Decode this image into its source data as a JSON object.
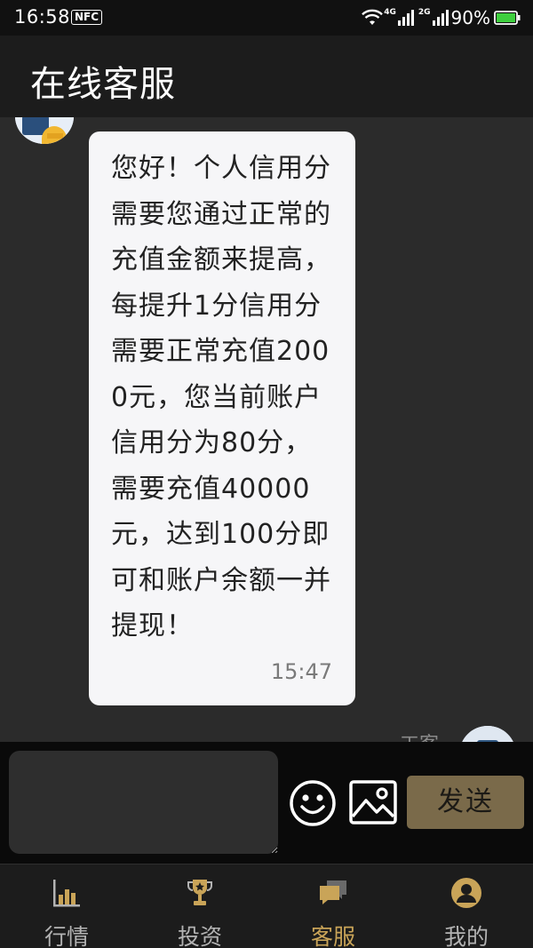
{
  "status_bar": {
    "time": "16:58",
    "nfc_label": "NFC",
    "network_1": "4G",
    "network_2": "2G",
    "battery": "90%"
  },
  "header": {
    "title": "在线客服"
  },
  "chat": {
    "messages": [
      {
        "text": "您好！个人信用分需要您通过正常的充值金额来提高，每提升1分信用分需要正常充值2000元，您当前账户信用分为80分，需要充值40000元，达到100分即可和账户余额一并提现！",
        "time": "15:47"
      }
    ],
    "next_sender_name": "工客"
  },
  "input_bar": {
    "input_value": "",
    "input_placeholder": "",
    "emoji_icon": "smiley-icon",
    "image_icon": "image-icon",
    "send_label": "发送"
  },
  "tab_bar": {
    "active_color": "#c9a458",
    "tabs": [
      {
        "label": "行情",
        "icon": "bar-chart-icon"
      },
      {
        "label": "投资",
        "icon": "trophy-icon"
      },
      {
        "label": "客服",
        "icon": "chat-bubbles-icon",
        "active": true
      },
      {
        "label": "我的",
        "icon": "user-icon"
      }
    ]
  }
}
